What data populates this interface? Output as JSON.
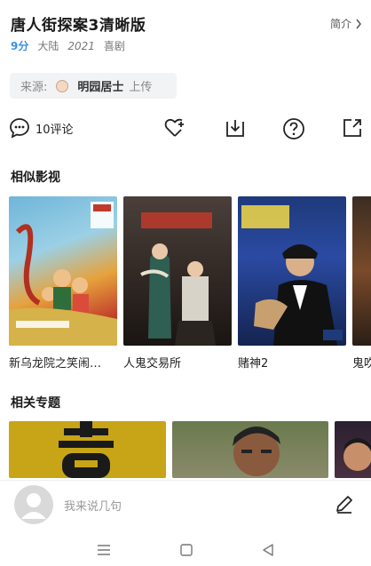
{
  "header": {
    "title": "唐人街探案3清晰版",
    "intro_label": "简介",
    "score": "9分",
    "region": "大陆",
    "year": "2021",
    "genre": "喜剧"
  },
  "source": {
    "prefix": "来源:",
    "uploader": "明园居士",
    "action": "上传"
  },
  "actions": {
    "comments_label": "10评论"
  },
  "similar": {
    "title": "相似影视",
    "items": [
      {
        "caption": "新乌龙院之笑闹…"
      },
      {
        "caption": "人鬼交易所"
      },
      {
        "caption": "赌神2"
      },
      {
        "caption": "鬼吹"
      }
    ]
  },
  "topics": {
    "title": "相关专题"
  },
  "comment": {
    "placeholder": "我来说几句"
  },
  "colors": {
    "accent": "#3a8ee6",
    "topic1": "#c8a417"
  }
}
